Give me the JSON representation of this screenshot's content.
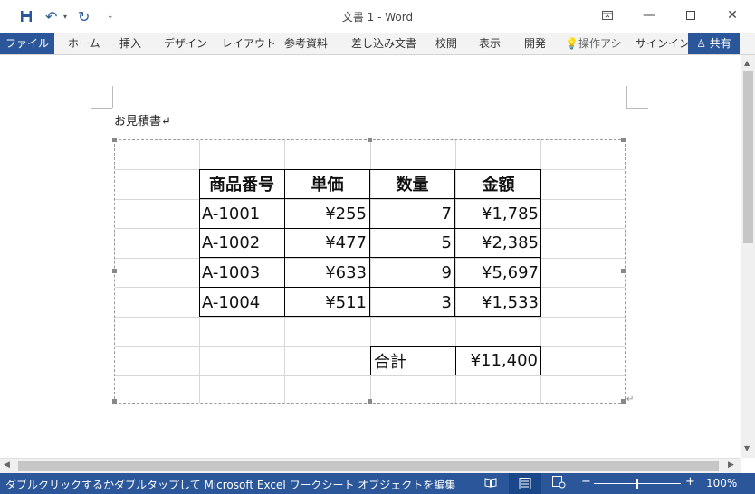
{
  "window": {
    "title": "文書 1 - Word"
  },
  "ribbon": {
    "tabs": [
      "ファイル",
      "ホーム",
      "挿入",
      "デザイン",
      "レイアウト",
      "参考資料",
      "差し込み文書",
      "校閲",
      "表示",
      "開発"
    ],
    "tell_me": "操作アシ",
    "signin": "サインイン",
    "share": "共有"
  },
  "document": {
    "heading": "お見積書↵"
  },
  "sheet": {
    "headers": [
      "商品番号",
      "単価",
      "数量",
      "金額"
    ],
    "rows": [
      [
        "A-1001",
        "¥255",
        "7",
        "¥1,785"
      ],
      [
        "A-1002",
        "¥477",
        "5",
        "¥2,385"
      ],
      [
        "A-1003",
        "¥633",
        "9",
        "¥5,697"
      ],
      [
        "A-1004",
        "¥511",
        "3",
        "¥1,533"
      ]
    ],
    "total_label": "合計",
    "total_value": "¥11,400",
    "end_mark": "↵"
  },
  "status": {
    "message": "ダブルクリックするかダブルタップして Microsoft Excel ワークシート オブジェクトを編集",
    "zoom": "100%"
  },
  "colors": {
    "accent": "#2b579a",
    "ribbon_bg": "#f3f3f3"
  }
}
